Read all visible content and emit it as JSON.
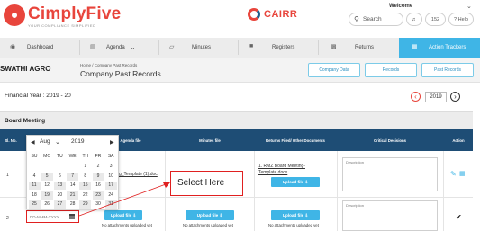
{
  "header": {
    "brand": "CimplyFive",
    "tagline": "YOUR COMPLIANCE SIMPLIFIED",
    "cairr": "CAIRR",
    "welcome": "Welcome",
    "search_placeholder": "Search",
    "notif_count": "152",
    "help_label": "Help"
  },
  "nav": {
    "items": [
      {
        "label": "Dashboard",
        "icon": "dashboard-icon"
      },
      {
        "label": "Agenda",
        "icon": "agenda-icon"
      },
      {
        "label": "Minutes",
        "icon": "minutes-icon"
      },
      {
        "label": "Registers",
        "icon": "registers-icon"
      },
      {
        "label": "Returns",
        "icon": "returns-icon"
      },
      {
        "label": "Action Trackers",
        "icon": "action-trackers-icon"
      }
    ],
    "active": "Action Trackers"
  },
  "subheader": {
    "company": "SWATHI AGRO",
    "breadcrumb": "Home  /  Company Past Records",
    "title": "Company Past Records",
    "buttons": [
      "Company Data",
      "Records",
      "Past Records"
    ]
  },
  "financial_year": {
    "label": "Financial Year : 2019 - 20",
    "year": "2019"
  },
  "section": {
    "title": "Board Meeting",
    "columns": [
      "Sl. No.",
      "Agenda file",
      "Minutes file",
      "Returns Filed/ Other Documents",
      "Critical Decisions",
      "Action"
    ],
    "rows": [
      {
        "sl": "1",
        "agenda_link": "g_Template (1).doc",
        "returns_link_1": "1. RMZ Board Meeting-",
        "returns_link_2": "Template.docx",
        "upload_label": "Upload file",
        "desc_placeholder": "Description"
      },
      {
        "sl": "2",
        "date_placeholder": "DD-MMM-YYYY",
        "upload_label": "Upload file",
        "no_attach": "No attachments uploaded yet",
        "desc_placeholder": "Description"
      }
    ]
  },
  "calendar": {
    "month": "Aug",
    "year": "2019",
    "day_headers": [
      "SU",
      "MO",
      "TU",
      "WE",
      "TH",
      "FR",
      "SA"
    ],
    "weeks": [
      [
        "",
        "",
        "",
        "",
        "1",
        "2",
        "3"
      ],
      [
        "4",
        "5",
        "6",
        "7",
        "8",
        "9",
        "10"
      ],
      [
        "11",
        "12",
        "13",
        "14",
        "15",
        "16",
        "17"
      ],
      [
        "18",
        "19",
        "20",
        "21",
        "22",
        "23",
        "24"
      ],
      [
        "25",
        "26",
        "27",
        "28",
        "29",
        "30",
        "31"
      ]
    ]
  },
  "callout": {
    "text": "Select Here"
  },
  "colors": {
    "brand_red": "#e8453c",
    "accent_blue": "#3fb5e6",
    "table_header": "#1e4d75"
  }
}
